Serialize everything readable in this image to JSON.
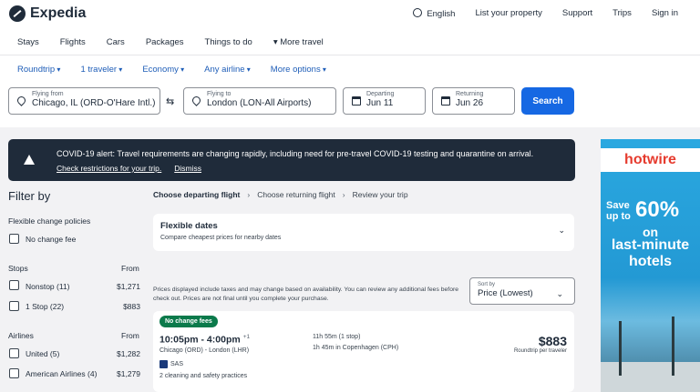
{
  "header": {
    "brand": "Expedia",
    "links": [
      "English",
      "List your property",
      "Support",
      "Trips",
      "Sign in"
    ]
  },
  "nav": {
    "items": [
      "Stays",
      "Flights",
      "Cars",
      "Packages",
      "Things to do",
      "More travel"
    ]
  },
  "search": {
    "options": [
      "Roundtrip",
      "1 traveler",
      "Economy",
      "Any airline",
      "More options"
    ],
    "from_label": "Flying from",
    "from_value": "Chicago, IL (ORD-O'Hare Intl.)",
    "to_label": "Flying to",
    "to_value": "London (LON-All Airports)",
    "depart_label": "Departing",
    "depart_value": "Jun 11",
    "return_label": "Returning",
    "return_value": "Jun 26",
    "button": "Search"
  },
  "alert": {
    "text": "COVID-19 alert: Travel requirements are changing rapidly, including need for pre-travel COVID-19 testing and quarantine on arrival.",
    "link_check": "Check restrictions for your trip.",
    "link_dismiss": "Dismiss"
  },
  "filters": {
    "title": "Filter by",
    "flex_heading": "Flexible change policies",
    "no_change_fee": "No change fee",
    "stops_heading": "Stops",
    "from_heading": "From",
    "stops": [
      {
        "label": "Nonstop (11)",
        "price": "$1,271"
      },
      {
        "label": "1 Stop (22)",
        "price": "$883"
      }
    ],
    "airlines_heading": "Airlines",
    "airlines": [
      {
        "label": "United (5)",
        "price": "$1,282"
      },
      {
        "label": "American Airlines (4)",
        "price": "$1,279"
      }
    ]
  },
  "steps": {
    "step1": "Choose departing flight",
    "step2": "Choose returning flight",
    "step3": "Review your trip"
  },
  "flexible": {
    "title": "Flexible dates",
    "subtitle": "Compare cheapest prices for nearby dates"
  },
  "disclaimer": "Prices displayed include taxes and may change based on availability. You can review any additional fees before check out. Prices are not final until you complete your purchase.",
  "sort": {
    "label": "Sort by",
    "value": "Price (Lowest)"
  },
  "flight": {
    "badge": "No change fees",
    "time": "10:05pm - 4:00pm",
    "plus_days": "+1",
    "route": "Chicago (ORD) - London (LHR)",
    "airline": "SAS",
    "cleaning": "2 cleaning and safety practices",
    "duration": "11h 55m (1 stop)",
    "layover": "1h 45m in Copenhagen (CPH)",
    "price": "$883",
    "price_sub": "Roundtrip per traveler"
  },
  "ad": {
    "brand": "hotwire",
    "line1a": "Save",
    "line1b": "up to",
    "big": "60%",
    "on": "on",
    "last": "last-minute hotels"
  },
  "colors": {
    "primary": "#1668e3",
    "link": "#1f5eb8",
    "alert_bg": "#1f2b3a",
    "badge_bg": "#0b7a4b"
  }
}
